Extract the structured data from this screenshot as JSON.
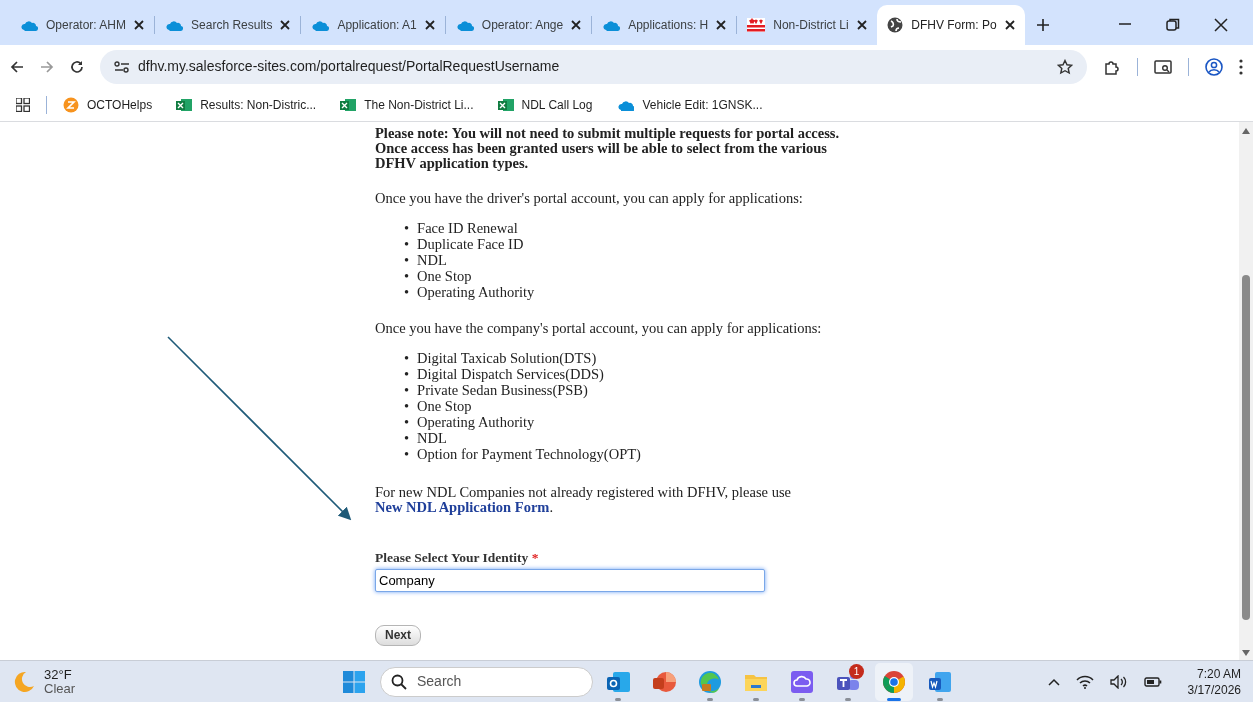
{
  "browser": {
    "tabs": [
      {
        "title": "Operator: AHM",
        "kind": "cloud",
        "selected": false
      },
      {
        "title": "Search Results",
        "kind": "cloud",
        "selected": false
      },
      {
        "title": "Application: A1",
        "kind": "cloud",
        "selected": false
      },
      {
        "title": "Operator: Ange",
        "kind": "cloud",
        "selected": false
      },
      {
        "title": "Applications: H",
        "kind": "cloud",
        "selected": false
      },
      {
        "title": "Non-District Li",
        "kind": "flag",
        "selected": false
      },
      {
        "title": "DFHV Form: Po",
        "kind": "globe",
        "selected": true
      }
    ],
    "url": "dfhv.my.salesforce-sites.com/portalrequest/PortalRequestUsername",
    "bookmarks": [
      {
        "label": "OCTOHelps",
        "kind": "spiral"
      },
      {
        "label": "Results: Non-Distric...",
        "kind": "sheet"
      },
      {
        "label": "The Non-District Li...",
        "kind": "sheet"
      },
      {
        "label": "NDL Call Log",
        "kind": "sheet"
      },
      {
        "label": "Vehicle Edit: 1GNSK...",
        "kind": "cloud"
      }
    ]
  },
  "page": {
    "notice": "Please note: You will not need to submit multiple requests for portal access. Once access has been granted users will be able to select from the various DFHV application types.",
    "driver_intro": "Once you have the driver's portal account, you can apply for applications:",
    "list_marker": "•",
    "driver_apps": [
      "Face ID Renewal",
      "Duplicate Face ID",
      "NDL",
      "One Stop",
      "Operating Authority"
    ],
    "company_intro": "Once you have the company's portal account, you can apply for applications:",
    "company_apps": [
      "Digital Taxicab Solution(DTS)",
      "Digital Dispatch Services(DDS)",
      "Private Sedan Business(PSB)",
      "One Stop",
      "Operating Authority",
      "NDL",
      "Option for Payment Technology(OPT)"
    ],
    "ndl_note": {
      "text": "For new NDL Companies not already registered with DFHV, please use",
      "link": "New NDL Application Form",
      "after": "."
    },
    "identity": {
      "label": "Please Select Your Identity",
      "required_mark": "*",
      "value": "Company"
    },
    "next_button": "Next"
  },
  "taskbar": {
    "weather": {
      "temperature": "32°F",
      "condition": "Clear"
    },
    "search_placeholder": "Search",
    "apps": [
      {
        "kind": "mail",
        "running": true,
        "active": false
      },
      {
        "kind": "slides",
        "running": false,
        "active": false
      },
      {
        "kind": "edge",
        "running": true,
        "active": false
      },
      {
        "kind": "folder",
        "running": true,
        "active": false
      },
      {
        "kind": "cloud",
        "running": true,
        "active": false
      },
      {
        "kind": "teams",
        "running": true,
        "active": false,
        "badge": "1"
      },
      {
        "kind": "chrome",
        "running": true,
        "active": true
      },
      {
        "kind": "word",
        "running": true,
        "active": false
      }
    ],
    "time": "7:20 AM",
    "date": "3/17/2026"
  }
}
